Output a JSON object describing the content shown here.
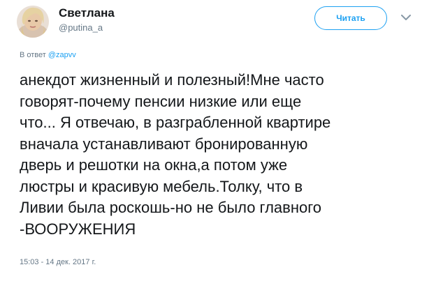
{
  "author": {
    "display_name": "Светлана",
    "handle": "@putina_a",
    "avatar": "avatar-photo"
  },
  "follow_button": {
    "label": "Читать",
    "accent": "#1da1f2"
  },
  "caret_icon": "chevron-down-icon",
  "reply_to": {
    "prefix": "В ответ",
    "mention": "@zapvv"
  },
  "tweet_text": "анекдот жизненный и полезный!Мне часто\nговорят-почему пенсии низкие или еще\nчто... Я отвечаю, в разграбленной квартире\nвначала устанавливают бронированную\nдверь и решотки на окна,а потом уже\nлюстры и красивую мебель.Толку, что в\nЛивии была роскошь-но не было главного\n-ВООРУЖЕНИЯ",
  "timestamp": "15:03 - 14 дек. 2017 г.",
  "colors": {
    "text": "#14171a",
    "secondary": "#657786",
    "link": "#1da1f2"
  }
}
